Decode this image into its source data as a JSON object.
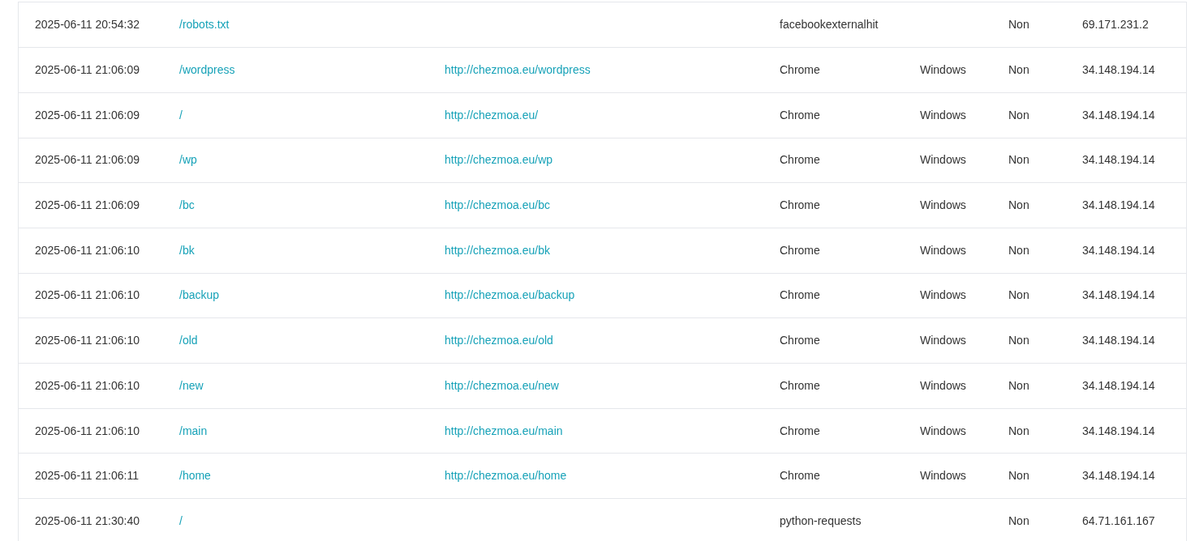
{
  "table": {
    "rows": [
      {
        "date": "2025-06-11 20:54:32",
        "page": "/robots.txt",
        "browser": "facebookexternalhit",
        "bot": "Non",
        "ip": "69.171.231.2"
      },
      {
        "date": "2025-06-11 21:06:09",
        "page": "/wordpress",
        "referer": "http://chezmoa.eu/wordpress",
        "browser": "Chrome",
        "os": "Windows",
        "bot": "Non",
        "ip": "34.148.194.14"
      },
      {
        "date": "2025-06-11 21:06:09",
        "page": "/",
        "referer": "http://chezmoa.eu/",
        "browser": "Chrome",
        "os": "Windows",
        "bot": "Non",
        "ip": "34.148.194.14"
      },
      {
        "date": "2025-06-11 21:06:09",
        "page": "/wp",
        "referer": "http://chezmoa.eu/wp",
        "browser": "Chrome",
        "os": "Windows",
        "bot": "Non",
        "ip": "34.148.194.14"
      },
      {
        "date": "2025-06-11 21:06:09",
        "page": "/bc",
        "referer": "http://chezmoa.eu/bc",
        "browser": "Chrome",
        "os": "Windows",
        "bot": "Non",
        "ip": "34.148.194.14"
      },
      {
        "date": "2025-06-11 21:06:10",
        "page": "/bk",
        "referer": "http://chezmoa.eu/bk",
        "browser": "Chrome",
        "os": "Windows",
        "bot": "Non",
        "ip": "34.148.194.14"
      },
      {
        "date": "2025-06-11 21:06:10",
        "page": "/backup",
        "referer": "http://chezmoa.eu/backup",
        "browser": "Chrome",
        "os": "Windows",
        "bot": "Non",
        "ip": "34.148.194.14"
      },
      {
        "date": "2025-06-11 21:06:10",
        "page": "/old",
        "referer": "http://chezmoa.eu/old",
        "browser": "Chrome",
        "os": "Windows",
        "bot": "Non",
        "ip": "34.148.194.14"
      },
      {
        "date": "2025-06-11 21:06:10",
        "page": "/new",
        "referer": "http://chezmoa.eu/new",
        "browser": "Chrome",
        "os": "Windows",
        "bot": "Non",
        "ip": "34.148.194.14"
      },
      {
        "date": "2025-06-11 21:06:10",
        "page": "/main",
        "referer": "http://chezmoa.eu/main",
        "browser": "Chrome",
        "os": "Windows",
        "bot": "Non",
        "ip": "34.148.194.14"
      },
      {
        "date": "2025-06-11 21:06:11",
        "page": "/home",
        "referer": "http://chezmoa.eu/home",
        "browser": "Chrome",
        "os": "Windows",
        "bot": "Non",
        "ip": "34.148.194.14"
      },
      {
        "date": "2025-06-11 21:30:40",
        "page": "/",
        "browser": "python-requests",
        "bot": "Non",
        "ip": "64.71.161.167"
      }
    ]
  }
}
